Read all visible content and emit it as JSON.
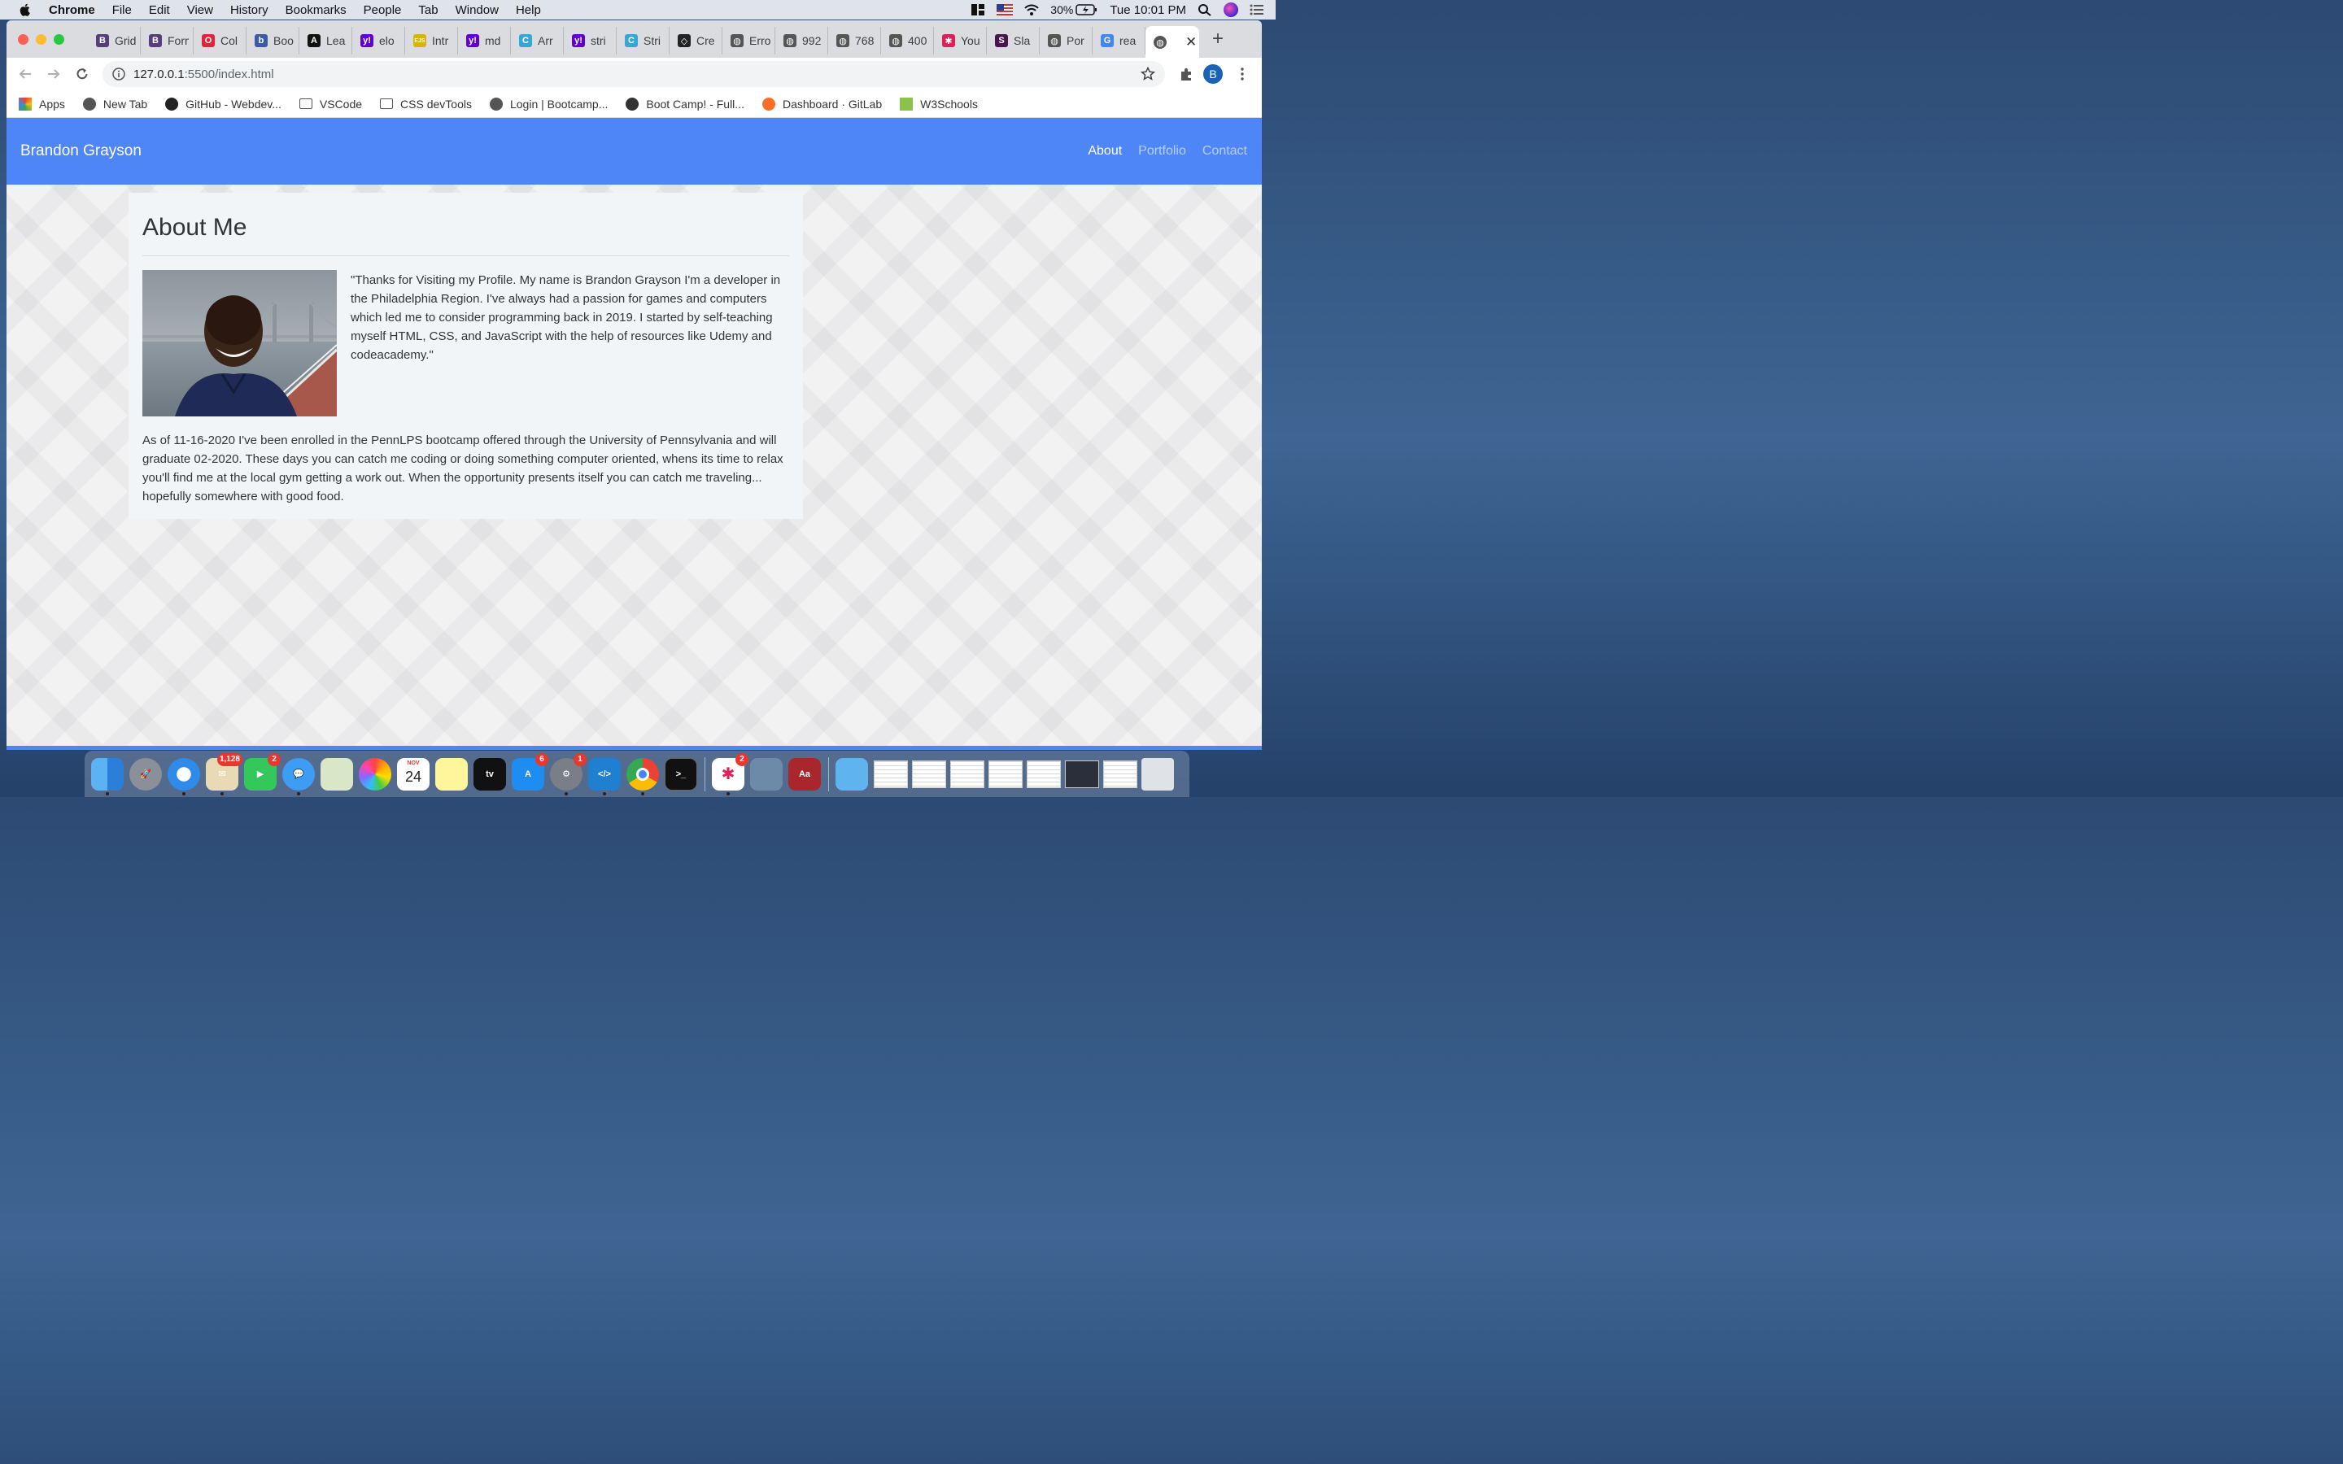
{
  "menubar": {
    "app_name": "Chrome",
    "items": [
      "File",
      "Edit",
      "View",
      "History",
      "Bookmarks",
      "People",
      "Tab",
      "Window",
      "Help"
    ],
    "battery": "30%",
    "clock": "Tue 10:01 PM"
  },
  "tabs": [
    {
      "title": "Grid",
      "icon": "bootstrap-icon",
      "color": "#563d7c",
      "glyph": "B"
    },
    {
      "title": "Forms",
      "icon": "bootstrap-icon",
      "color": "#563d7c",
      "glyph": "B"
    },
    {
      "title": "Col",
      "icon": "opera-icon",
      "color": "#e3223b",
      "glyph": "O"
    },
    {
      "title": "Boo",
      "icon": "bootstrap-icon",
      "color": "#3b5ba5",
      "glyph": "b"
    },
    {
      "title": "Lea",
      "icon": "learn-icon",
      "color": "#111111",
      "glyph": "A"
    },
    {
      "title": "elo",
      "icon": "yahoo-icon",
      "color": "#5f01d1",
      "glyph": "y!"
    },
    {
      "title": "Intr",
      "icon": "ejs-icon",
      "color": "#d6b30f",
      "glyph": "EJS"
    },
    {
      "title": "md",
      "icon": "yahoo-icon",
      "color": "#5f01d1",
      "glyph": "y!"
    },
    {
      "title": "Arr",
      "icon": "cheetah-icon",
      "color": "#33a8d6",
      "glyph": "C"
    },
    {
      "title": "stri",
      "icon": "yahoo-icon",
      "color": "#5f01d1",
      "glyph": "y!"
    },
    {
      "title": "Stri",
      "icon": "cheetah-icon",
      "color": "#33a8d6",
      "glyph": "C"
    },
    {
      "title": "Cre",
      "icon": "codepen-icon",
      "color": "#222222",
      "glyph": "◇"
    },
    {
      "title": "Erro",
      "icon": "globe-icon",
      "color": "#555555",
      "glyph": "◍"
    },
    {
      "title": "992",
      "icon": "globe-icon",
      "color": "#555555",
      "glyph": "◍"
    },
    {
      "title": "768",
      "icon": "globe-icon",
      "color": "#555555",
      "glyph": "◍"
    },
    {
      "title": "400",
      "icon": "globe-icon",
      "color": "#555555",
      "glyph": "◍"
    },
    {
      "title": "You",
      "icon": "slack-icon",
      "color": "#e01e5a",
      "glyph": "✱"
    },
    {
      "title": "Sla",
      "icon": "slack-icon",
      "color": "#4a154b",
      "glyph": "S"
    },
    {
      "title": "Por",
      "icon": "globe-icon",
      "color": "#555555",
      "glyph": "◍"
    },
    {
      "title": "rea",
      "icon": "google-icon",
      "color": "#4285f4",
      "glyph": "G"
    }
  ],
  "active_tab": {
    "icon": "globe-icon",
    "glyph": "◍"
  },
  "address": {
    "host": "127.0.0.1",
    "rest": ":5500/index.html"
  },
  "profile_initial": "B",
  "bookmarks": [
    {
      "label": "Apps",
      "icon": "apps-grid-icon"
    },
    {
      "label": "New Tab",
      "icon": "globe-icon"
    },
    {
      "label": "GitHub - Webdev...",
      "icon": "github-icon"
    },
    {
      "label": "VSCode",
      "icon": "folder-icon"
    },
    {
      "label": "CSS devTools",
      "icon": "folder-icon"
    },
    {
      "label": "Login | Bootcamp...",
      "icon": "globe-icon"
    },
    {
      "label": "Boot Camp! - Full...",
      "icon": "book-icon"
    },
    {
      "label": "Dashboard · GitLab",
      "icon": "gitlab-icon"
    },
    {
      "label": "W3Schools",
      "icon": "w3schools-icon"
    }
  ],
  "site": {
    "brand": "Brandon Grayson",
    "nav": [
      "About",
      "Portfolio",
      "Contact"
    ],
    "heading": "About Me",
    "intro": "\"Thanks for Visiting my Profile. My name is Brandon Grayson I'm a developer in the Philadelphia Region. I've always had a passion for games and computers which led me to consider programming back in 2019. I started by self-teaching myself HTML, CSS, and JavaScript with the help of resources like Udemy and codeacademy.\"",
    "more": "As of 11-16-2020 I've been enrolled in the PennLPS bootcamp offered through the University of Pennsylvania and will graduate 02-2020. These days you can catch me coding or doing something computer oriented, whens its time to relax you'll find me at the local gym getting a work out. When the opportunity presents itself you can catch me traveling... hopefully somewhere with good food."
  },
  "dock": {
    "mail_badge": "1,128",
    "facetime_badge": "2",
    "calendar_month": "NOV",
    "calendar_day": "24",
    "tv_label": "tv",
    "appstore_badge": "6",
    "settings_badge": "1",
    "slack_badge": "2",
    "dictionary_label": "Aa"
  },
  "colors": {
    "navbar": "#4f86f7",
    "card": "#f1f5f8"
  }
}
